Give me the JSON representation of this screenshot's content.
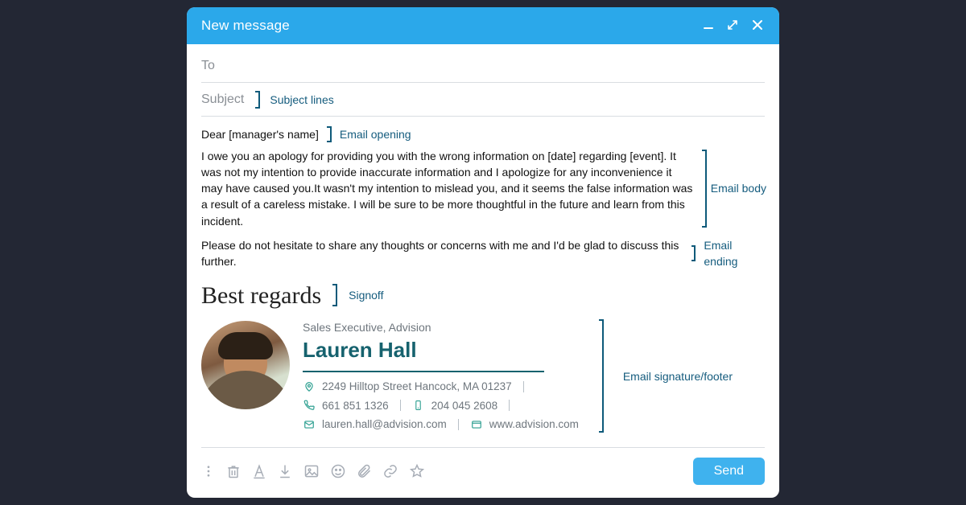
{
  "window": {
    "title": "New message"
  },
  "fields": {
    "to_label": "To",
    "subject_label": "Subject"
  },
  "annotations": {
    "subject": "Subject lines",
    "opening": "Email opening",
    "body": "Email body",
    "ending": "Email ending",
    "signoff": "Signoff",
    "signature": "Email signature/footer"
  },
  "email": {
    "opening": "Dear [manager's name]",
    "body": "I owe you an apology for providing you with the wrong information on [date] regarding [event]. It was not my intention to provide inaccurate information and I apologize for any inconvenience it may have caused you.It wasn't my intention to mislead you, and it seems the false information was a result of a careless mistake. I will be sure to be more thoughtful in the future and learn from this incident.",
    "ending": "Please do not hesitate to share any thoughts or concerns with me and I'd be glad to discuss this further.",
    "signoff": "Best regards"
  },
  "signature": {
    "title": "Sales Executive, Advision",
    "name": "Lauren Hall",
    "address": "2249 Hilltop Street Hancock, MA 01237",
    "phone": "661 851 1326",
    "mobile": "204 045 2608",
    "email": "lauren.hall@advision.com",
    "website": "www.advision.com"
  },
  "buttons": {
    "send": "Send"
  },
  "icons": {
    "minimize": "minimize",
    "restore": "restore",
    "close": "close",
    "more": "more",
    "trash": "trash",
    "font": "font",
    "download": "download",
    "image": "image",
    "emoji": "emoji",
    "attach": "attach",
    "link": "link",
    "star": "star"
  }
}
